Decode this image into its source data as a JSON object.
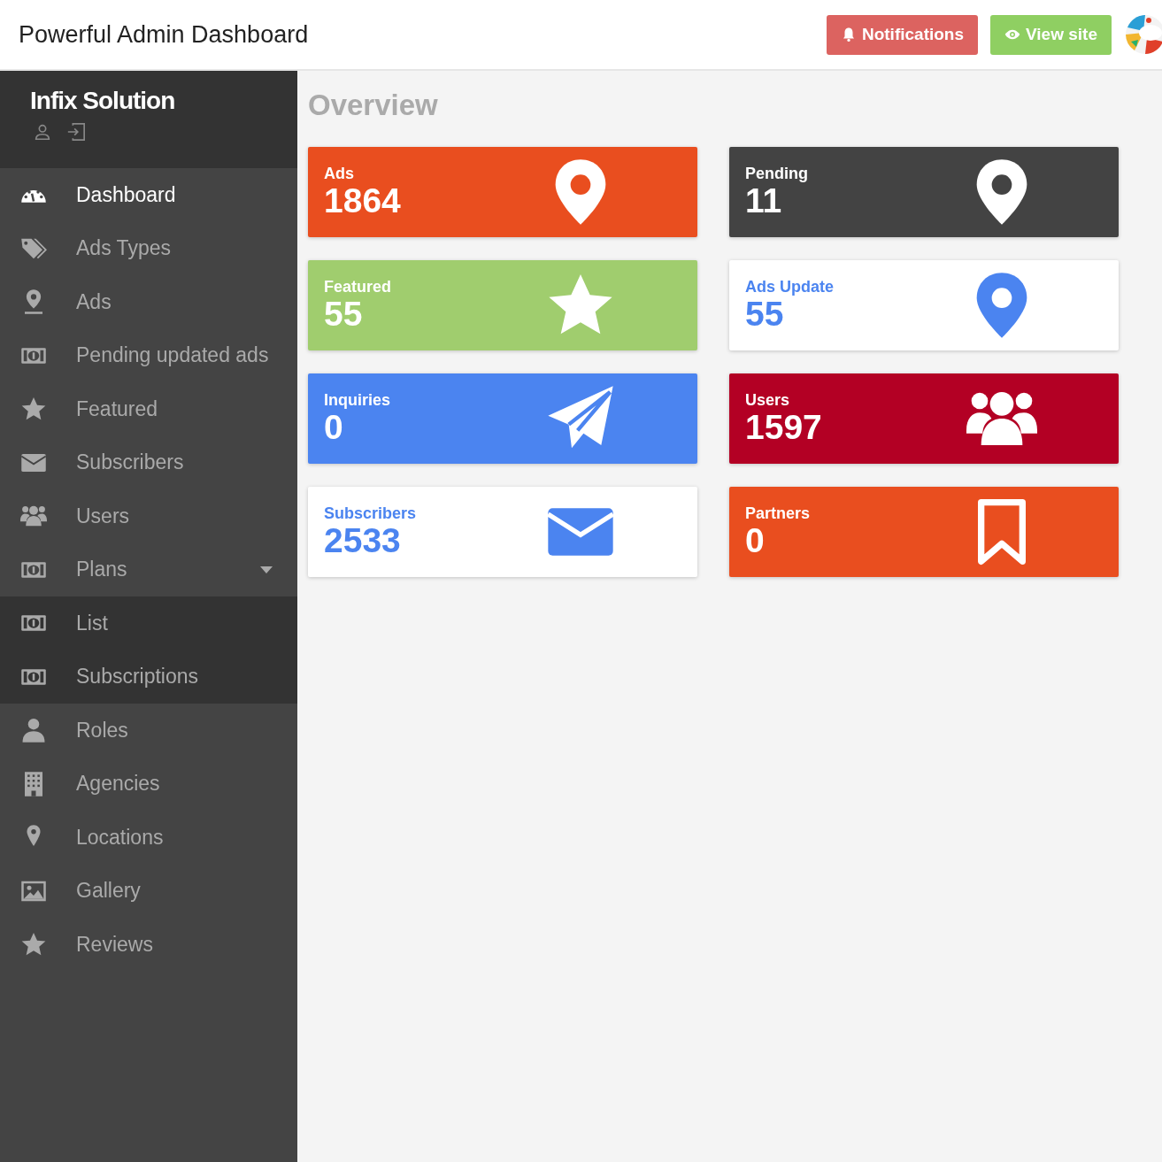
{
  "header": {
    "title": "Powerful Admin Dashboard",
    "buttons": [
      {
        "label": "Notifications",
        "kind": "notify"
      },
      {
        "label": "View site",
        "kind": "view"
      }
    ]
  },
  "sidebar": {
    "brand": "Infix Solution",
    "items": [
      {
        "label": "Dashboard",
        "selected": true
      },
      {
        "label": "Ads Types",
        "selected": false
      },
      {
        "label": "Ads",
        "selected": false
      },
      {
        "label": "Pending updated ads",
        "selected": false
      },
      {
        "label": "Featured",
        "selected": false
      },
      {
        "label": "Subscribers",
        "selected": false
      },
      {
        "label": "Users",
        "selected": false
      },
      {
        "label": "Plans",
        "selected": false,
        "expanded": true,
        "children": [
          {
            "label": "List",
            "selected": false
          },
          {
            "label": "Subscriptions",
            "selected": false
          }
        ]
      },
      {
        "label": "Roles",
        "selected": false
      },
      {
        "label": "Agencies",
        "selected": false
      },
      {
        "label": "Locations",
        "selected": false
      },
      {
        "label": "Gallery",
        "selected": false
      },
      {
        "label": "Reviews",
        "selected": false
      }
    ]
  },
  "main": {
    "title": "Overview",
    "cards": [
      {
        "label": "Ads",
        "value": "1864",
        "color": "#e94e1f",
        "kind": "solid"
      },
      {
        "label": "Pending",
        "value": "11",
        "color": "#434343",
        "kind": "solid"
      },
      {
        "label": "Featured",
        "value": "55",
        "color": "#a0cd6e",
        "kind": "solid"
      },
      {
        "label": "Ads Update",
        "value": "55",
        "color": "#4b84f0",
        "kind": "outline"
      },
      {
        "label": "Inquiries",
        "value": "0",
        "color": "#4b84f0",
        "kind": "solid"
      },
      {
        "label": "Users",
        "value": "1597",
        "color": "#b30024",
        "kind": "solid"
      },
      {
        "label": "Subscribers",
        "value": "2533",
        "color": "#4b84f0",
        "kind": "outline"
      },
      {
        "label": "Partners",
        "value": "0",
        "color": "#e94e1f",
        "kind": "solid"
      }
    ]
  }
}
